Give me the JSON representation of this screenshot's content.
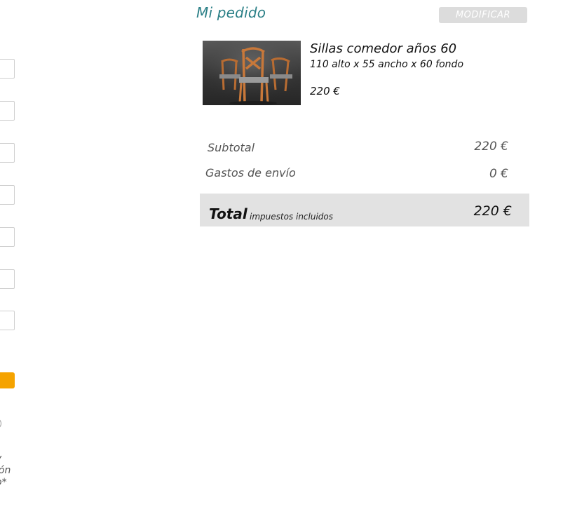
{
  "left_form": {
    "partial_text": "y\nión\no*"
  },
  "order": {
    "title": "Mi pedido",
    "modify_label": "MODIFICAR"
  },
  "product": {
    "name": "Sillas comedor años 60",
    "dimensions": "110 alto x 55 ancho x 60 fondo",
    "price": "220 €"
  },
  "summary": {
    "subtotal_label": "Subtotal",
    "subtotal_value": "220 €",
    "shipping_label": "Gastos de envío",
    "shipping_value": "0 €",
    "total_label": "Total",
    "total_note": "impuestos incluidos",
    "total_value": "220 €"
  },
  "colors": {
    "accent_title": "#2a7f86",
    "orange_button": "#f5a300",
    "total_bg": "#e2e2e2"
  }
}
